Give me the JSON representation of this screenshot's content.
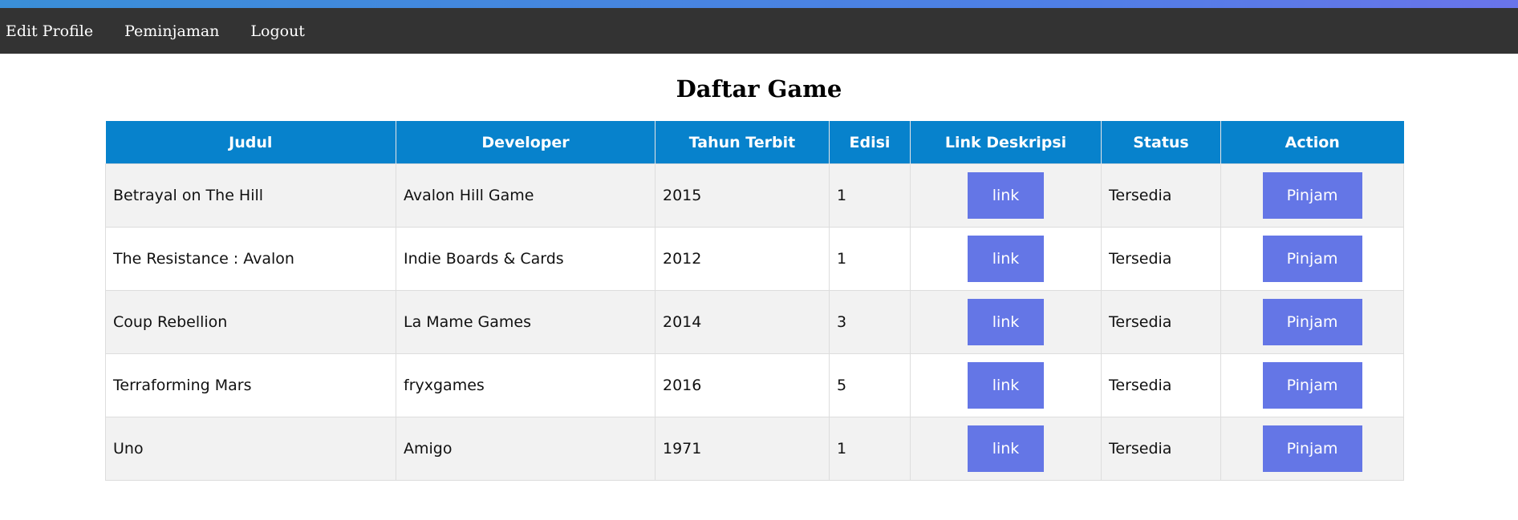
{
  "nav": {
    "items": [
      {
        "label": "Edit Profile"
      },
      {
        "label": "Peminjaman"
      },
      {
        "label": "Logout"
      }
    ]
  },
  "page": {
    "title": "Daftar Game"
  },
  "table": {
    "headers": [
      "Judul",
      "Developer",
      "Tahun Terbit",
      "Edisi",
      "Link Deskripsi",
      "Status",
      "Action"
    ],
    "rows": [
      {
        "judul": "Betrayal on The Hill",
        "developer": "Avalon Hill Game",
        "tahun": "2015",
        "edisi": "1",
        "link_label": "link",
        "status": "Tersedia",
        "action_label": "Pinjam"
      },
      {
        "judul": "The Resistance : Avalon",
        "developer": "Indie Boards & Cards",
        "tahun": "2012",
        "edisi": "1",
        "link_label": "link",
        "status": "Tersedia",
        "action_label": "Pinjam"
      },
      {
        "judul": "Coup Rebellion",
        "developer": "La Mame Games",
        "tahun": "2014",
        "edisi": "3",
        "link_label": "link",
        "status": "Tersedia",
        "action_label": "Pinjam"
      },
      {
        "judul": "Terraforming Mars",
        "developer": "fryxgames",
        "tahun": "2016",
        "edisi": "5",
        "link_label": "link",
        "status": "Tersedia",
        "action_label": "Pinjam"
      },
      {
        "judul": "Uno",
        "developer": "Amigo",
        "tahun": "1971",
        "edisi": "1",
        "link_label": "link",
        "status": "Tersedia",
        "action_label": "Pinjam"
      }
    ]
  },
  "colors": {
    "navbar_bg": "#333333",
    "header_bg": "#0782cc",
    "button_bg": "#6476e6",
    "row_alt_bg": "#f2f2f2"
  }
}
